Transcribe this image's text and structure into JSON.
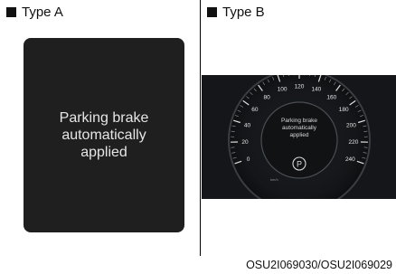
{
  "type_a": {
    "label": "Type A",
    "message": "Parking brake\nautomatically\napplied"
  },
  "type_b": {
    "label": "Type B",
    "message": "Parking brake\nautomatically\napplied",
    "speed_ticks": [
      "0",
      "20",
      "40",
      "60",
      "80",
      "100",
      "120",
      "140",
      "160",
      "180",
      "200",
      "220",
      "240"
    ],
    "speed_unit": "km/h",
    "parking_symbol": "P"
  },
  "caption": "OSU2I069030/OSU2I069029",
  "colors": {
    "screen_bg": "#1f1f1f",
    "cluster_bg": "#141619",
    "parking_icon_border": "#d9d9d9"
  }
}
